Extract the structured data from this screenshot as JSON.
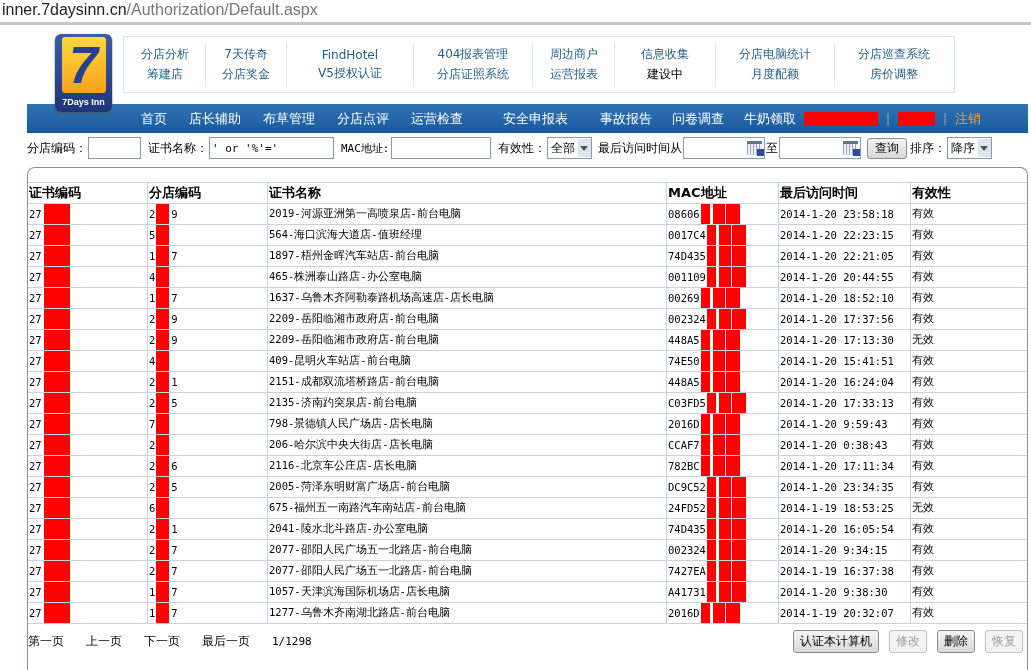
{
  "address_bar": {
    "host": "inner.7daysinn.cn",
    "path": "/Authorization/Default.aspx"
  },
  "logo": {
    "numeral": "7",
    "name": "7Days Inn"
  },
  "header_links": [
    {
      "top": {
        "label": "分店分析",
        "link": true
      },
      "bottom": {
        "label": "筹建店",
        "link": true
      }
    },
    {
      "top": {
        "label": "7天传奇",
        "link": true
      },
      "bottom": {
        "label": "分店奖金",
        "link": true
      }
    },
    {
      "top": {
        "label": "FindHotel",
        "link": true
      },
      "bottom": {
        "label": "V5授权认证",
        "link": true
      }
    },
    {
      "top": {
        "label": "404报表管理",
        "link": true
      },
      "bottom": {
        "label": "分店证照系统",
        "link": true
      }
    },
    {
      "top": {
        "label": "周边商户",
        "link": true
      },
      "bottom": {
        "label": "运营报表",
        "link": true
      }
    },
    {
      "top": {
        "label": "信息收集",
        "link": true
      },
      "bottom": {
        "label": "建设中",
        "link": false
      }
    },
    {
      "top": {
        "label": "分店电脑统计",
        "link": true
      },
      "bottom": {
        "label": "月度配额",
        "link": true
      }
    },
    {
      "top": {
        "label": "分店巡查系统",
        "link": true
      },
      "bottom": {
        "label": "房价调整",
        "link": true
      }
    }
  ],
  "nav": [
    {
      "kind": "link",
      "label": "首页"
    },
    {
      "kind": "link",
      "label": "店长辅助"
    },
    {
      "kind": "link",
      "label": "布草管理"
    },
    {
      "kind": "link",
      "label": "分店点评"
    },
    {
      "kind": "link",
      "label": "运营检查"
    },
    {
      "kind": "link",
      "label": "安全申报表"
    },
    {
      "kind": "link",
      "label": "事故报告"
    },
    {
      "kind": "link",
      "label": "问卷调查"
    },
    {
      "kind": "link",
      "label": "牛奶领取"
    },
    {
      "kind": "redacted"
    },
    {
      "kind": "separator",
      "label": "|"
    },
    {
      "kind": "redacted"
    },
    {
      "kind": "separator",
      "label": "|"
    },
    {
      "kind": "logout",
      "label": "注销"
    }
  ],
  "filters": {
    "shop_code": {
      "label": "分店编码："
    },
    "cert_name": {
      "label": "证书名称：",
      "value": "' or '%'='"
    },
    "mac": {
      "label": "MAC地址:"
    },
    "validity": {
      "label": "有效性：",
      "value": "全部"
    },
    "time_from": {
      "label": "最后访问时间从"
    },
    "time_to": {
      "label": "至"
    },
    "search_button": "查询",
    "sort": {
      "label": "排序：",
      "value": "降序"
    }
  },
  "table": {
    "columns": [
      "证书编码",
      "分店编码",
      "证书名称",
      "MAC地址",
      "最后访问时间",
      "有效性"
    ],
    "rows": [
      {
        "cert_code": "27",
        "shop_code_start": "2",
        "shop_code_end": "9",
        "cert_name": "2019-河源亚洲第一高喷泉店-前台电脑",
        "mac": "08606",
        "last_access": "2014-1-20 23:58:18",
        "validity": "有效"
      },
      {
        "cert_code": "27",
        "shop_code_start": "5",
        "cert_name": "564-海口滨海大道店-值班经理",
        "mac": "0017C4",
        "last_access": "2014-1-20 22:23:15",
        "validity": "有效"
      },
      {
        "cert_code": "27",
        "shop_code_start": "1",
        "shop_code_end": "7",
        "cert_name": "1897-梧州金晖汽车站店-前台电脑",
        "mac": "74D435",
        "last_access": "2014-1-20 22:21:05",
        "validity": "有效"
      },
      {
        "cert_code": "27",
        "shop_code_start": "4",
        "cert_name": "465-株洲泰山路店-办公室电脑",
        "mac": "001109",
        "last_access": "2014-1-20 20:44:55",
        "validity": "有效"
      },
      {
        "cert_code": "27",
        "shop_code_start": "1",
        "shop_code_end": "7",
        "cert_name": "1637-乌鲁木齐阿勒泰路机场高速店-店长电脑",
        "mac": "00269",
        "last_access": "2014-1-20 18:52:10",
        "validity": "有效"
      },
      {
        "cert_code": "27",
        "shop_code_start": "2",
        "shop_code_end": "9",
        "cert_name": "2209-岳阳临湘市政府店-前台电脑",
        "mac": "002324",
        "last_access": "2014-1-20 17:37:56",
        "validity": "有效"
      },
      {
        "cert_code": "27",
        "shop_code_start": "2",
        "shop_code_end": "9",
        "cert_name": "2209-岳阳临湘市政府店-前台电脑",
        "mac": "448A5",
        "last_access": "2014-1-20 17:13:30",
        "validity": "无效"
      },
      {
        "cert_code": "27",
        "shop_code_start": "4",
        "cert_name": "409-昆明火车站店-前台电脑",
        "mac": "74E50",
        "last_access": "2014-1-20 15:41:51",
        "validity": "有效"
      },
      {
        "cert_code": "27",
        "shop_code_start": "2",
        "shop_code_end": "1",
        "cert_name": "2151-成都双流塔桥路店-前台电脑",
        "mac": "448A5",
        "last_access": "2014-1-20 16:24:04",
        "validity": "有效"
      },
      {
        "cert_code": "27",
        "shop_code_start": "2",
        "shop_code_end": "5",
        "cert_name": "2135-济南趵突泉店-前台电脑",
        "mac": "C03FD5",
        "last_access": "2014-1-20 17:33:13",
        "validity": "有效"
      },
      {
        "cert_code": "27",
        "shop_code_start": "7",
        "cert_name": "798-景德镇人民广场店-店长电脑",
        "mac": "2016D",
        "last_access": "2014-1-20 9:59:43",
        "validity": "有效"
      },
      {
        "cert_code": "27",
        "shop_code_start": "2",
        "cert_name": "206-哈尔滨中央大街店-店长电脑",
        "mac": "CCAF7",
        "last_access": "2014-1-20 0:38:43",
        "validity": "有效"
      },
      {
        "cert_code": "27",
        "shop_code_start": "2",
        "shop_code_end": "6",
        "cert_name": "2116-北京车公庄店-店长电脑",
        "mac": "782BC",
        "last_access": "2014-1-20 17:11:34",
        "validity": "有效"
      },
      {
        "cert_code": "27",
        "shop_code_start": "2",
        "shop_code_end": "5",
        "cert_name": "2005-菏泽东明财富广场店-前台电脑",
        "mac": "DC9C52",
        "last_access": "2014-1-20 23:34:35",
        "validity": "有效"
      },
      {
        "cert_code": "27",
        "shop_code_start": "6",
        "cert_name": "675-福州五一南路汽车南站店-前台电脑",
        "mac": "24FD52",
        "last_access": "2014-1-19 18:53:25",
        "validity": "无效"
      },
      {
        "cert_code": "27",
        "shop_code_start": "2",
        "shop_code_end": "1",
        "cert_name": "2041-陵水北斗路店-办公室电脑",
        "mac": "74D435",
        "last_access": "2014-1-20 16:05:54",
        "validity": "有效"
      },
      {
        "cert_code": "27",
        "shop_code_start": "2",
        "shop_code_end": "7",
        "cert_name": "2077-邵阳人民广场五一北路店-前台电脑",
        "mac": "002324",
        "last_access": "2014-1-20 9:34:15",
        "validity": "有效"
      },
      {
        "cert_code": "27",
        "shop_code_start": "2",
        "shop_code_end": "7",
        "cert_name": "2077-邵阳人民广场五一北路店-前台电脑",
        "mac": "7427EA",
        "last_access": "2014-1-19 16:37:38",
        "validity": "有效"
      },
      {
        "cert_code": "27",
        "shop_code_start": "1",
        "shop_code_end": "7",
        "cert_name": "1057-天津滨海国际机场店-店长电脑",
        "mac": "A41731",
        "last_access": "2014-1-20 9:38:30",
        "validity": "有效"
      },
      {
        "cert_code": "27",
        "shop_code_start": "1",
        "shop_code_end": "7",
        "cert_name": "1277-乌鲁木齐南湖北路店-前台电脑",
        "mac": "2016D",
        "last_access": "2014-1-19 20:32:07",
        "validity": "有效"
      }
    ]
  },
  "pager": {
    "links": [
      "第一页",
      "上一页",
      "下一页",
      "最后一页"
    ],
    "page": "1/1298"
  },
  "actions": [
    {
      "label": "认证本计算机",
      "disabled": false
    },
    {
      "label": "修改",
      "disabled": true
    },
    {
      "label": "删除",
      "disabled": false
    },
    {
      "label": "恢复",
      "disabled": true
    }
  ]
}
